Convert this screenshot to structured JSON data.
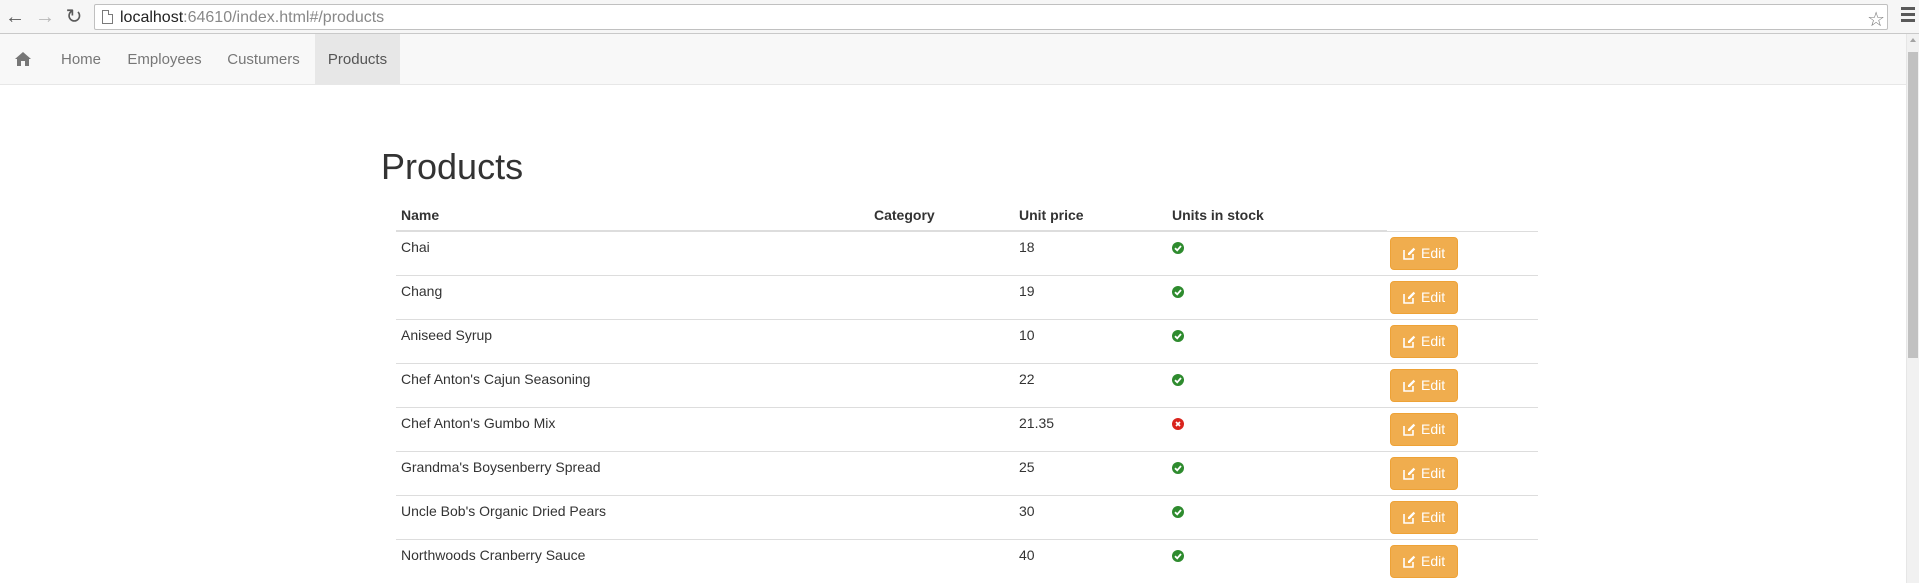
{
  "browser": {
    "url_host": "localhost",
    "url_rest": ":64610/index.html#/products"
  },
  "navbar": {
    "items": [
      {
        "label": "Home"
      },
      {
        "label": "Employees"
      },
      {
        "label": "Custumers"
      },
      {
        "label": "Products"
      }
    ],
    "active": "Products"
  },
  "page": {
    "title": "Products"
  },
  "table": {
    "headers": {
      "name": "Name",
      "category": "Category",
      "unit_price": "Unit price",
      "units_in_stock": "Units in stock"
    },
    "edit_label": "Edit",
    "rows": [
      {
        "name": "Chai",
        "category": "",
        "unit_price": "18",
        "in_stock": true
      },
      {
        "name": "Chang",
        "category": "",
        "unit_price": "19",
        "in_stock": true
      },
      {
        "name": "Aniseed Syrup",
        "category": "",
        "unit_price": "10",
        "in_stock": true
      },
      {
        "name": "Chef Anton's Cajun Seasoning",
        "category": "",
        "unit_price": "22",
        "in_stock": true
      },
      {
        "name": "Chef Anton's Gumbo Mix",
        "category": "",
        "unit_price": "21.35",
        "in_stock": false
      },
      {
        "name": "Grandma's Boysenberry Spread",
        "category": "",
        "unit_price": "25",
        "in_stock": true
      },
      {
        "name": "Uncle Bob's Organic Dried Pears",
        "category": "",
        "unit_price": "30",
        "in_stock": true
      },
      {
        "name": "Northwoods Cranberry Sauce",
        "category": "",
        "unit_price": "40",
        "in_stock": true
      }
    ]
  },
  "colors": {
    "edit_button": "#f0ad4e",
    "in_stock": "#2e8b2e",
    "out_of_stock": "#d9241d",
    "navbar_bg": "#f8f8f8",
    "navbar_active": "#e7e7e7"
  }
}
